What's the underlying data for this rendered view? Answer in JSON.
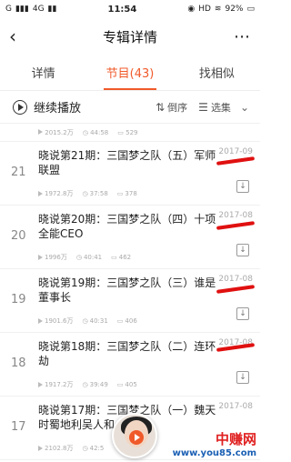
{
  "status": {
    "carrier": "G",
    "network": "4G",
    "time": "11:54",
    "hd": "HD",
    "battery": "92%"
  },
  "header": {
    "title": "专辑详情",
    "back_icon": "arrow-left-icon",
    "more_icon": "more-dots-icon"
  },
  "tabs": [
    {
      "label": "详情"
    },
    {
      "label": "节目(43)"
    },
    {
      "label": "找相似"
    }
  ],
  "toolbar": {
    "continue_label": "继续播放",
    "order_label": "倒序",
    "select_label": "选集"
  },
  "prev_meta": {
    "plays": "2015.2万",
    "duration": "44:58",
    "comments": "529"
  },
  "episodes": [
    {
      "num": "21",
      "title": "晓说第21期：三国梦之队（五）军师联盟",
      "date": "2017-09",
      "plays": "1972.8万",
      "duration": "37:58",
      "comments": "378"
    },
    {
      "num": "20",
      "title": "晓说第20期：三国梦之队（四）十项全能CEO",
      "date": "2017-08",
      "plays": "1996万",
      "duration": "40:41",
      "comments": "462"
    },
    {
      "num": "19",
      "title": "晓说第19期：三国梦之队（三）谁是董事长",
      "date": "2017-08",
      "plays": "1901.6万",
      "duration": "40:31",
      "comments": "406"
    },
    {
      "num": "18",
      "title": "晓说第18期：三国梦之队（二）连环劫",
      "date": "2017-08",
      "plays": "1917.2万",
      "duration": "39:49",
      "comments": "405"
    },
    {
      "num": "17",
      "title": "晓说第17期：三国梦之队（一）魏天时蜀地利吴人和",
      "date": "2017-08",
      "plays": "2102.8万",
      "duration": "42:5",
      "comments": ""
    }
  ],
  "watermark": {
    "name": "中赚网",
    "url": "www.you85.com"
  },
  "colors": {
    "accent": "#f05a2a",
    "annotation": "#e01010"
  }
}
